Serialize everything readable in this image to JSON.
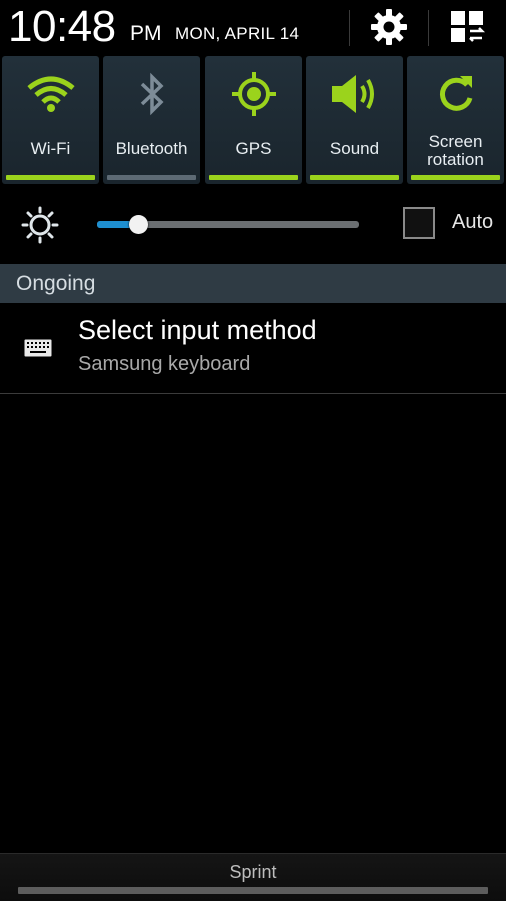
{
  "status": {
    "time": "10:48",
    "ampm": "PM",
    "date": "MON, APRIL 14"
  },
  "header_icons": {
    "settings": "gear-icon",
    "grid": "grid-icon"
  },
  "toggles": [
    {
      "label": "Wi-Fi",
      "icon": "wifi-icon",
      "on": true
    },
    {
      "label": "Bluetooth",
      "icon": "bluetooth-icon",
      "on": false
    },
    {
      "label": "GPS",
      "icon": "gps-icon",
      "on": true
    },
    {
      "label": "Sound",
      "icon": "sound-icon",
      "on": true
    },
    {
      "label": "Screen rotation",
      "label_line1": "Screen",
      "label_line2": "rotation",
      "icon": "rotation-icon",
      "on": true
    }
  ],
  "colors": {
    "active": "#9bd31c",
    "inactive_icon": "#7d8c98",
    "inactive_bar": "#5d6a74",
    "slider_fill": "#1e8fd0",
    "section_header": "#2f3b44"
  },
  "brightness": {
    "level": 0.16,
    "auto_label": "Auto",
    "auto_checked": false
  },
  "ongoing": {
    "header": "Ongoing",
    "notification": {
      "title": "Select input method",
      "subtitle": "Samsung keyboard",
      "icon": "keyboard-icon"
    }
  },
  "carrier": {
    "label": "Sprint"
  }
}
